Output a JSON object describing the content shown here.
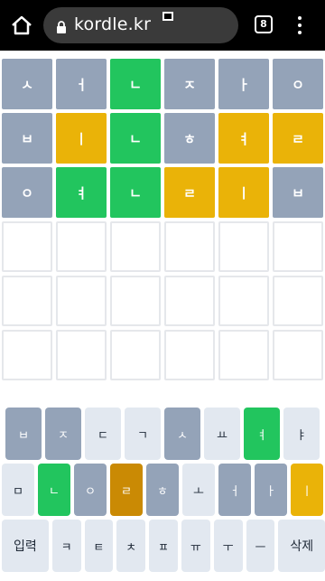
{
  "browser": {
    "url": "kordle.kr",
    "tab_count": "8"
  },
  "board": {
    "rows": [
      [
        {
          "ch": "ㅅ",
          "state": "gray"
        },
        {
          "ch": "ㅓ",
          "state": "gray"
        },
        {
          "ch": "ㄴ",
          "state": "green"
        },
        {
          "ch": "ㅈ",
          "state": "gray"
        },
        {
          "ch": "ㅏ",
          "state": "gray"
        },
        {
          "ch": "ㅇ",
          "state": "gray"
        }
      ],
      [
        {
          "ch": "ㅂ",
          "state": "gray"
        },
        {
          "ch": "ㅣ",
          "state": "yellow"
        },
        {
          "ch": "ㄴ",
          "state": "green"
        },
        {
          "ch": "ㅎ",
          "state": "gray"
        },
        {
          "ch": "ㅕ",
          "state": "yellow"
        },
        {
          "ch": "ㄹ",
          "state": "yellow"
        }
      ],
      [
        {
          "ch": "ㅇ",
          "state": "gray"
        },
        {
          "ch": "ㅕ",
          "state": "green"
        },
        {
          "ch": "ㄴ",
          "state": "green"
        },
        {
          "ch": "ㄹ",
          "state": "yellow"
        },
        {
          "ch": "ㅣ",
          "state": "yellow"
        },
        {
          "ch": "ㅂ",
          "state": "gray"
        }
      ],
      [
        {
          "ch": "",
          "state": "empty"
        },
        {
          "ch": "",
          "state": "empty"
        },
        {
          "ch": "",
          "state": "empty"
        },
        {
          "ch": "",
          "state": "empty"
        },
        {
          "ch": "",
          "state": "empty"
        },
        {
          "ch": "",
          "state": "empty"
        }
      ],
      [
        {
          "ch": "",
          "state": "empty"
        },
        {
          "ch": "",
          "state": "empty"
        },
        {
          "ch": "",
          "state": "empty"
        },
        {
          "ch": "",
          "state": "empty"
        },
        {
          "ch": "",
          "state": "empty"
        },
        {
          "ch": "",
          "state": "empty"
        }
      ],
      [
        {
          "ch": "",
          "state": "empty"
        },
        {
          "ch": "",
          "state": "empty"
        },
        {
          "ch": "",
          "state": "empty"
        },
        {
          "ch": "",
          "state": "empty"
        },
        {
          "ch": "",
          "state": "empty"
        },
        {
          "ch": "",
          "state": "empty"
        }
      ]
    ]
  },
  "keyboard": {
    "rows": [
      [
        {
          "label": "ㅂ",
          "state": "gray"
        },
        {
          "label": "ㅈ",
          "state": "gray"
        },
        {
          "label": "ㄷ",
          "state": "default"
        },
        {
          "label": "ㄱ",
          "state": "default"
        },
        {
          "label": "ㅅ",
          "state": "gray"
        },
        {
          "label": "ㅛ",
          "state": "default"
        },
        {
          "label": "ㅕ",
          "state": "green"
        },
        {
          "label": "ㅑ",
          "state": "default"
        }
      ],
      [
        {
          "label": "ㅁ",
          "state": "default"
        },
        {
          "label": "ㄴ",
          "state": "green"
        },
        {
          "label": "ㅇ",
          "state": "gray"
        },
        {
          "label": "ㄹ",
          "state": "dkyellow"
        },
        {
          "label": "ㅎ",
          "state": "gray"
        },
        {
          "label": "ㅗ",
          "state": "default"
        },
        {
          "label": "ㅓ",
          "state": "gray"
        },
        {
          "label": "ㅏ",
          "state": "gray"
        },
        {
          "label": "ㅣ",
          "state": "yellow"
        }
      ],
      [
        {
          "label": "입력",
          "state": "default",
          "wide": true
        },
        {
          "label": "ㅋ",
          "state": "default"
        },
        {
          "label": "ㅌ",
          "state": "default"
        },
        {
          "label": "ㅊ",
          "state": "default"
        },
        {
          "label": "ㅍ",
          "state": "default"
        },
        {
          "label": "ㅠ",
          "state": "default"
        },
        {
          "label": "ㅜ",
          "state": "default"
        },
        {
          "label": "ㅡ",
          "state": "default"
        },
        {
          "label": "삭제",
          "state": "default",
          "wide": true
        }
      ]
    ]
  },
  "colors": {
    "absent": "#94a3b8",
    "correct": "#22c55e",
    "present": "#eab308",
    "key_default": "#e2e8f0"
  }
}
